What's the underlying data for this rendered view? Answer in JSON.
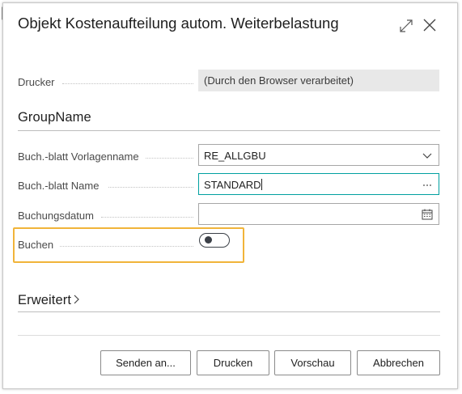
{
  "dialog": {
    "title": "Objekt Kostenaufteilung autom. Weiterbelastung"
  },
  "icons": {
    "expand": "expand-icon",
    "close": "close-icon",
    "cursor": "mouse-cursor-icon",
    "dropdown": "chevron-down-icon",
    "lookup": "ellipsis-icon",
    "calendar": "calendar-icon"
  },
  "printer": {
    "label": "Drucker",
    "value": "(Durch den Browser verarbeitet)"
  },
  "group": {
    "title": "GroupName",
    "fields": {
      "template_label": "Buch.-blatt Vorlagenname",
      "template_value": "RE_ALLGBU",
      "batch_label": "Buch.-blatt Name",
      "batch_value": "STANDARD",
      "date_label": "Buchungsdatum",
      "date_value": "",
      "post_label": "Buchen",
      "post_value": false
    }
  },
  "advanced": {
    "title": "Erweitert"
  },
  "footer": {
    "send_label": "Senden an...",
    "print_label": "Drucken",
    "preview_label": "Vorschau",
    "cancel_label": "Abbrechen"
  },
  "colors": {
    "highlight": "#f1b43a",
    "focus_border": "#00a0a0"
  }
}
